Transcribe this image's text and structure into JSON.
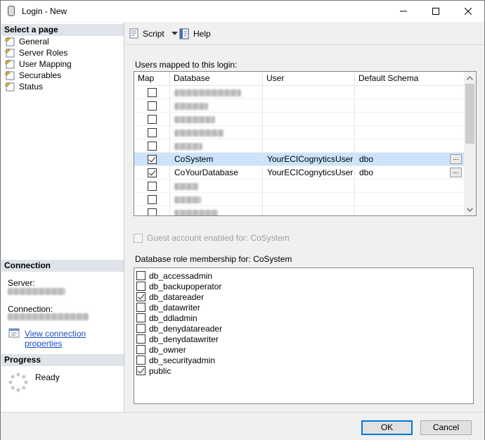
{
  "window": {
    "title": "Login - New"
  },
  "left": {
    "select_page_header": "Select a page",
    "pages": [
      "General",
      "Server Roles",
      "User Mapping",
      "Securables",
      "Status"
    ],
    "connection_header": "Connection",
    "server_label": "Server:",
    "connection_label": "Connection:",
    "view_connection_link": "View connection properties",
    "progress_header": "Progress",
    "progress_status": "Ready"
  },
  "toolbar": {
    "script_label": "Script",
    "help_label": "Help"
  },
  "mapping": {
    "label": "Users mapped to this login:",
    "columns": [
      "Map",
      "Database",
      "User",
      "Default Schema"
    ],
    "rows": [
      {
        "map": false,
        "database": "",
        "user": "",
        "schema": "",
        "blurred": true,
        "selected": false
      },
      {
        "map": false,
        "database": "",
        "user": "",
        "schema": "",
        "blurred": true,
        "selected": false
      },
      {
        "map": false,
        "database": "",
        "user": "",
        "schema": "",
        "blurred": true,
        "selected": false
      },
      {
        "map": false,
        "database": "",
        "user": "",
        "schema": "",
        "blurred": true,
        "selected": false
      },
      {
        "map": false,
        "database": "",
        "user": "",
        "schema": "",
        "blurred": true,
        "selected": false
      },
      {
        "map": true,
        "database": "CoSystem",
        "user": "YourECICognyticsUser",
        "schema": "dbo",
        "blurred": false,
        "selected": true
      },
      {
        "map": true,
        "database": "CoYourDatabase",
        "user": "YourECICognyticsUser",
        "schema": "dbo",
        "blurred": false,
        "selected": false
      },
      {
        "map": false,
        "database": "",
        "user": "",
        "schema": "",
        "blurred": true,
        "selected": false
      },
      {
        "map": false,
        "database": "",
        "user": "",
        "schema": "",
        "blurred": true,
        "selected": false
      },
      {
        "map": false,
        "database": "",
        "user": "",
        "schema": "",
        "blurred": true,
        "selected": false
      }
    ],
    "ellipsis": "..."
  },
  "guest": {
    "label": "Guest account enabled for: CoSystem",
    "checked": false,
    "enabled": false
  },
  "roles": {
    "label": "Database role membership for: CoSystem",
    "items": [
      {
        "name": "db_accessadmin",
        "checked": false
      },
      {
        "name": "db_backupoperator",
        "checked": false
      },
      {
        "name": "db_datareader",
        "checked": true
      },
      {
        "name": "db_datawriter",
        "checked": false
      },
      {
        "name": "db_ddladmin",
        "checked": false
      },
      {
        "name": "db_denydatareader",
        "checked": false
      },
      {
        "name": "db_denydatawriter",
        "checked": false
      },
      {
        "name": "db_owner",
        "checked": false
      },
      {
        "name": "db_securityadmin",
        "checked": false
      },
      {
        "name": "public",
        "checked": true
      }
    ]
  },
  "buttons": {
    "ok": "OK",
    "cancel": "Cancel"
  },
  "colors": {
    "selected_row": "#cce3fb",
    "link": "#1a4fbf",
    "default_button_border": "#0078d7",
    "section_header": "#dfe3ea"
  }
}
